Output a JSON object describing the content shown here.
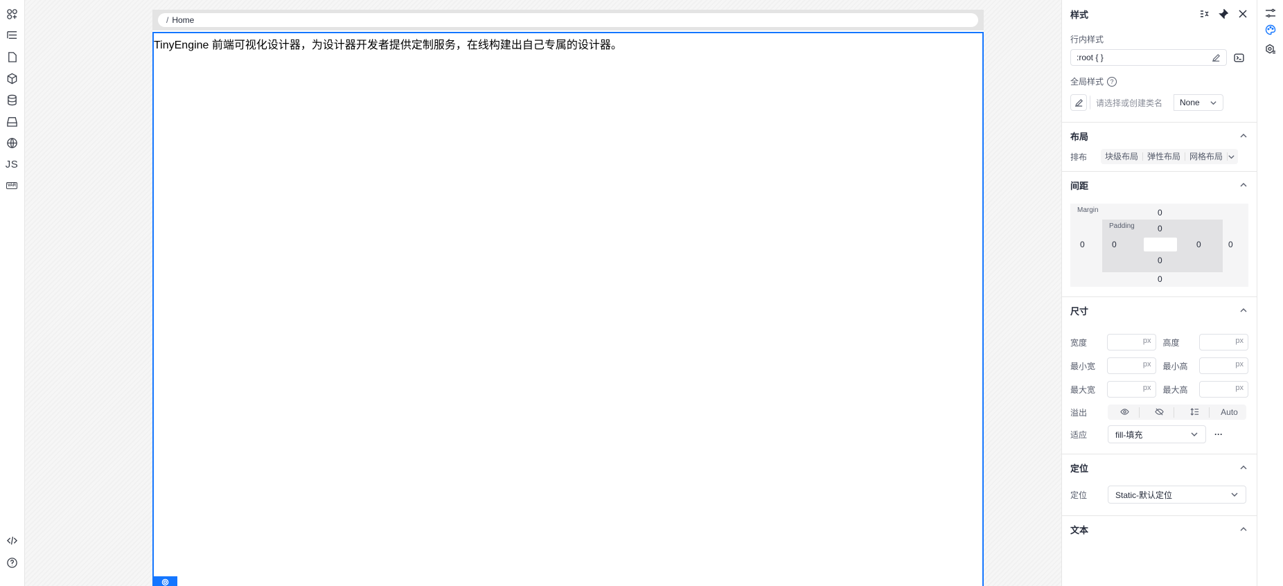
{
  "canvas": {
    "breadcrumb": {
      "separator": "/",
      "page": "Home"
    },
    "text": "TinyEngine 前端可视化设计器，为设计器开发者提供定制服务，在线构建出自己专属的设计器。"
  },
  "panel": {
    "title": "样式",
    "inline_style": {
      "label": "行内样式",
      "value": ":root { }"
    },
    "global_style": {
      "label": "全局样式",
      "help": "?",
      "class_placeholder": "请选择或创建类名",
      "state_value": "None"
    },
    "layout": {
      "title": "布局",
      "arrange_label": "排布",
      "options": [
        "块级布局",
        "弹性布局",
        "网格布局"
      ]
    },
    "spacing": {
      "title": "间距",
      "margin_label": "Margin",
      "padding_label": "Padding",
      "margin": {
        "top": "0",
        "right": "0",
        "bottom": "0",
        "left": "0"
      },
      "padding": {
        "top": "0",
        "right": "0",
        "bottom": "0",
        "left": "0"
      }
    },
    "size": {
      "title": "尺寸",
      "unit": "px",
      "width": "宽度",
      "height": "高度",
      "min_width": "最小宽",
      "min_height": "最小高",
      "max_width": "最大宽",
      "max_height": "最大高",
      "overflow_label": "溢出",
      "overflow_auto": "Auto",
      "fit_label": "适应",
      "fit_value": "fill-填充",
      "more": "···"
    },
    "position": {
      "title": "定位",
      "label": "定位",
      "value": "Static-默认定位"
    },
    "text_section": {
      "title": "文本"
    }
  },
  "colors": {
    "accent": "#1476ff"
  }
}
